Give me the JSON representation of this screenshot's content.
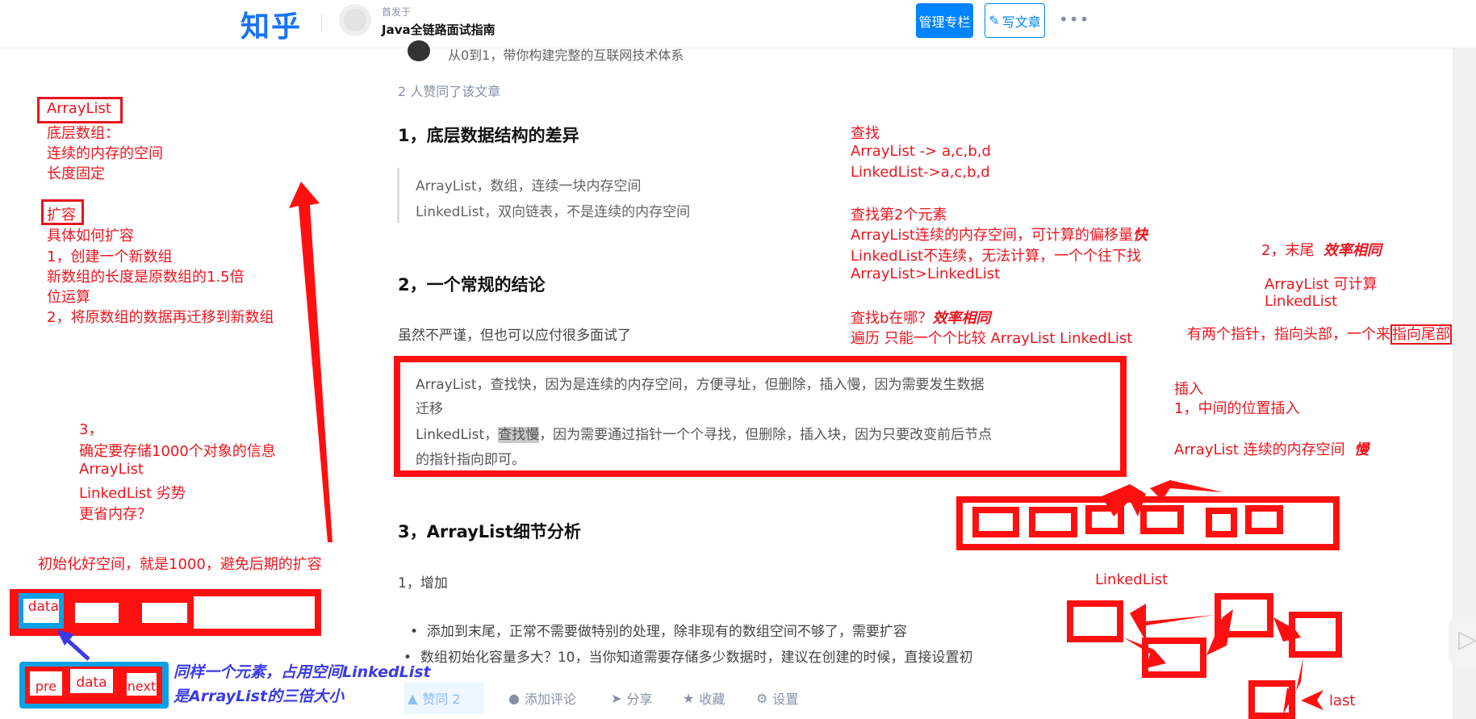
{
  "header": {
    "logo": "知乎",
    "column_prefix": "首发于",
    "column_name": "Java全链路面试指南",
    "manage_button": "管理专栏",
    "write_button": "写文章",
    "more": "•••"
  },
  "article": {
    "author_bio": "从0到1，带你构建完整的互联网技术体系",
    "likes_text": "2 人赞同了该文章",
    "h1": "1，底层数据结构的差异",
    "quote": [
      "ArrayList，数组，连续一块内存空间",
      "LinkedList，双向链表，不是连续的内存空间"
    ],
    "h2": "2，一个常规的结论",
    "p1": "虽然不严谨，但也可以应付很多面试了",
    "box_lines": {
      "l1": "ArrayList，查找快，因为是连续的内存空间，方便寻址，但删除，插入慢，因为需要发生数据",
      "l2": "迁移",
      "l3_pre": "LinkedList，",
      "l3_hl": "查找慢",
      "l3_post": "，因为需要通过指针一个个寻找，但删除，插入块，因为只要改变前后节点",
      "l4": "的指针指向即可。"
    },
    "h3": "3，ArrayList细节分析",
    "p2": "1，增加",
    "bullets": [
      "添加到末尾，正常不需要做特别的处理，除非现有的数组空间不够了，需要扩容",
      "数组初始化容量多大？10，当你知道需要存储多少数据时，建议在创建的时候，直接设置初"
    ]
  },
  "actions": {
    "upvote": "赞同 2",
    "comment": "添加评论",
    "share": "分享",
    "favorite": "收藏",
    "settings": "设置"
  },
  "annotations": {
    "left": {
      "title": "ArrayList",
      "l1": "底层数组：",
      "l2": "连续的内存的空间",
      "l3": "长度固定",
      "expand": "扩容",
      "e1": "具体如何扩容",
      "e2": "1，创建一个新数组",
      "e3": "新数组的长度是原数组的1.5倍",
      "e4": "位运算",
      "e5": "2，将原数组的数据再迁移到新数组",
      "n1": "3，",
      "n2": "确定要存储1000个对象的信息",
      "n3": "ArrayList",
      "n4": "LinkedList  劣势",
      "n5": "更省内存？",
      "init": "初始化好空间，就是1000，避免后期的扩容",
      "cell_data": "data",
      "pre": "pre",
      "data2": "data",
      "next": "next",
      "blue1": "同样一个元素，占用空间LinkedList",
      "blue2": "是ArrayList的三倍大小"
    },
    "right": {
      "s1": "查找",
      "s2": "ArrayList -> a,c,b,d",
      "s3": "LinkedList->a,c,b,d",
      "s4": "查找第2个元素",
      "s5": "ArrayList连续的内存空间，可计算的偏移量",
      "s5b": "快",
      "s6": "LinkedList不连续，无法计算，一个个往下找",
      "s7": "ArrayList>LinkedList",
      "s8": "查找b在哪？",
      "s8b": "效率相同",
      "s9": "遍历 只能一个个比较 ArrayList LinkedList",
      "t1": "2，末尾",
      "t1b": "效率相同",
      "t2": "ArrayList 可计算",
      "t3": "LinkedList",
      "t4": "有两个指针，指向头部，一个来",
      "t4box": "指向尾部",
      "i1": "插入",
      "i2": "1，中间的位置插入",
      "i3": "ArrayList 连续的内存空间",
      "i3b": "慢",
      "ll": "LinkedList",
      "last": "last"
    }
  },
  "colors": {
    "brand": "#0084ff",
    "annotation_red": "#f0141e",
    "annotation_blue": "#3b3be6",
    "box_blue": "#0aa0e6"
  }
}
